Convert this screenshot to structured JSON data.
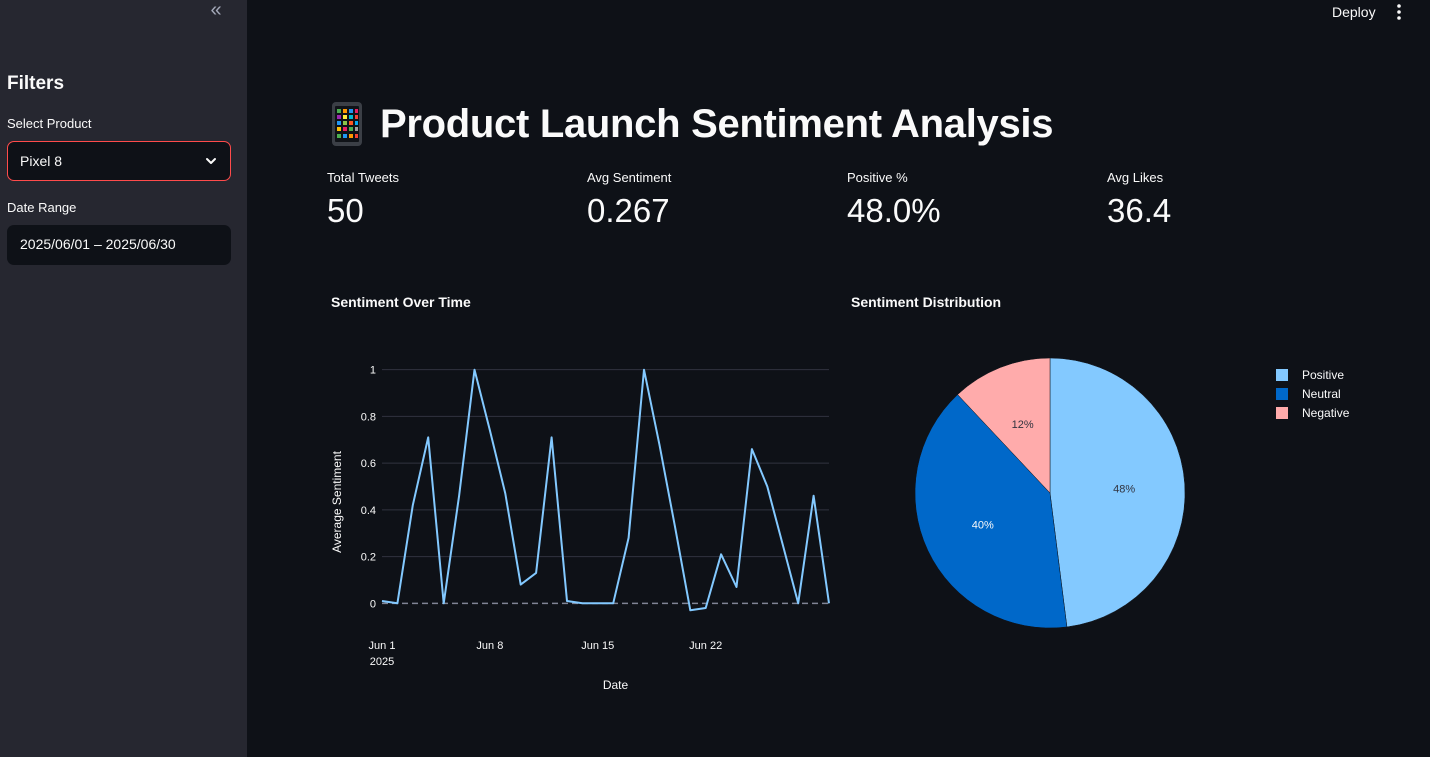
{
  "sidebar": {
    "heading": "Filters",
    "product_label": "Select Product",
    "product_value": "Pixel 8",
    "date_label": "Date Range",
    "date_value": "2025/06/01 – 2025/06/30"
  },
  "topbar": {
    "deploy_label": "Deploy"
  },
  "title": "Product Launch Sentiment Analysis",
  "metrics": [
    {
      "label": "Total Tweets",
      "value": "50"
    },
    {
      "label": "Avg Sentiment",
      "value": "0.267"
    },
    {
      "label": "Positive %",
      "value": "48.0%"
    },
    {
      "label": "Avg Likes",
      "value": "36.4"
    }
  ],
  "line_chart_title": "Sentiment Over Time",
  "pie_chart_title": "Sentiment Distribution",
  "colors": {
    "accent": "#ff4b4b",
    "line": "#83c9ff",
    "positive": "#83c9ff",
    "neutral": "#0068c9",
    "negative": "#ffabab"
  },
  "chart_data": [
    {
      "type": "line",
      "title": "Sentiment Over Time",
      "xlabel": "Date",
      "ylabel": "Average Sentiment",
      "x_tick_labels": [
        "Jun 1",
        "Jun 8",
        "Jun 15",
        "Jun 22"
      ],
      "x_tick_sublabel": "2025",
      "y_ticks": [
        "0",
        "0.2",
        "0.4",
        "0.6",
        "0.8",
        "1"
      ],
      "ylim": [
        -0.05,
        1.02
      ],
      "reference_line": 0,
      "x": [
        "2025-06-01",
        "2025-06-02",
        "2025-06-03",
        "2025-06-04",
        "2025-06-05",
        "2025-06-06",
        "2025-06-07",
        "2025-06-08",
        "2025-06-09",
        "2025-06-10",
        "2025-06-11",
        "2025-06-12",
        "2025-06-13",
        "2025-06-14",
        "2025-06-15",
        "2025-06-16",
        "2025-06-17",
        "2025-06-18",
        "2025-06-19",
        "2025-06-20",
        "2025-06-21",
        "2025-06-22",
        "2025-06-23",
        "2025-06-24",
        "2025-06-25",
        "2025-06-26",
        "2025-06-27",
        "2025-06-28",
        "2025-06-29",
        "2025-06-30"
      ],
      "series": [
        {
          "values": [
            0.01,
            0.0,
            0.42,
            0.71,
            0.0,
            0.46,
            1.0,
            0.74,
            0.47,
            0.08,
            0.13,
            0.71,
            0.01,
            0.0,
            0.0,
            0.0,
            0.28,
            1.0,
            0.68,
            0.33,
            -0.03,
            -0.02,
            0.21,
            0.07,
            0.66,
            0.5,
            0.25,
            0.0,
            0.46,
            0.0
          ]
        }
      ],
      "grid": true
    },
    {
      "type": "pie",
      "title": "Sentiment Distribution",
      "legend_position": "right",
      "slices": [
        {
          "label": "Positive",
          "value": 48,
          "text": "48%"
        },
        {
          "label": "Neutral",
          "value": 40,
          "text": "40%"
        },
        {
          "label": "Negative",
          "value": 12,
          "text": "12%"
        }
      ]
    }
  ]
}
